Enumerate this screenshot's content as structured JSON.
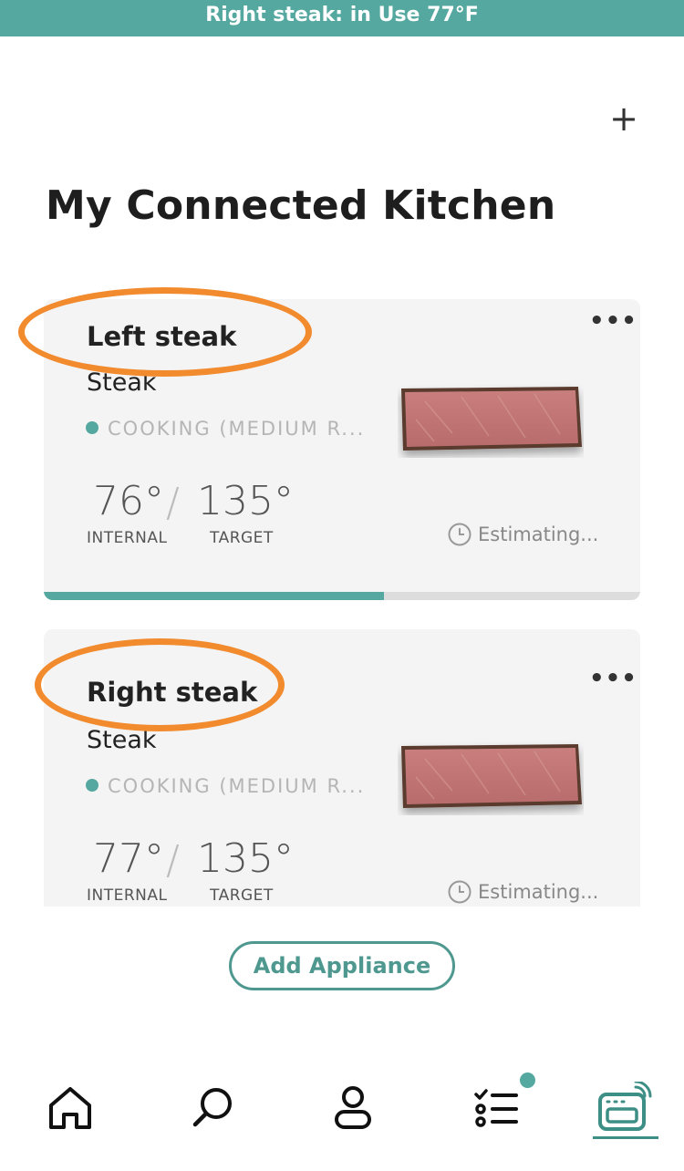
{
  "status_banner": "Right steak: in Use 77°F",
  "header": {
    "add_icon": "plus-icon",
    "title": "My Connected Kitchen"
  },
  "cards": [
    {
      "name": "Left steak",
      "type": "Steak",
      "status": "COOKING (MEDIUM R...",
      "internal": "76°",
      "target": "135°",
      "internal_label": "INTERNAL",
      "target_label": "TARGET",
      "estimate": "Estimating...",
      "progress": 0.57
    },
    {
      "name": "Right steak",
      "type": "Steak",
      "status": "COOKING (MEDIUM R...",
      "internal": "77°",
      "target": "135°",
      "internal_label": "INTERNAL",
      "target_label": "TARGET",
      "estimate": "Estimating..."
    }
  ],
  "add_appliance_label": "Add Appliance",
  "tabbar": {
    "items": [
      "home-icon",
      "search-icon",
      "profile-icon",
      "tasks-icon",
      "appliances-icon"
    ],
    "active": "appliances-icon"
  },
  "colors": {
    "accent": "#55a89f",
    "annotation": "#f28a2e"
  }
}
